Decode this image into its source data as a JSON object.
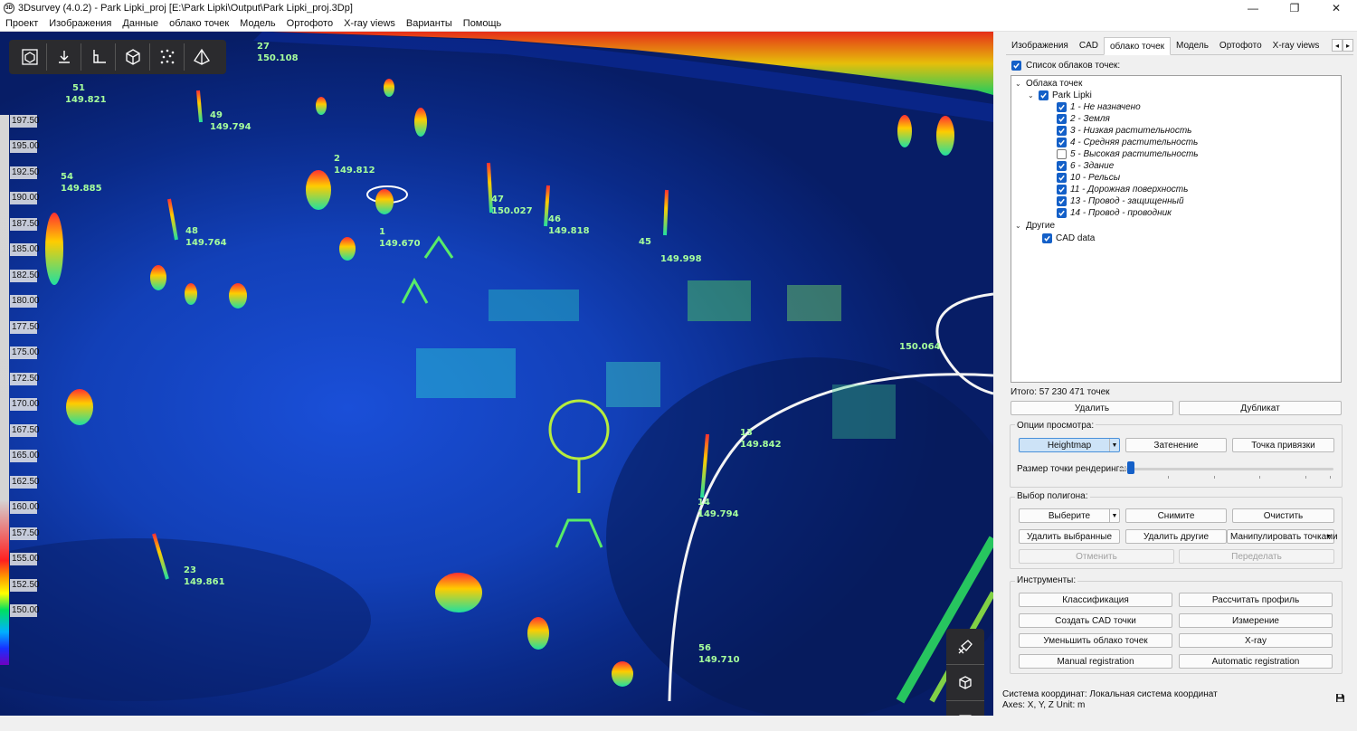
{
  "window": {
    "title": "3Dsurvey (4.0.2) - Park Lipki_proj [E:\\Park Lipki\\Output\\Park Lipki_proj.3Dp]",
    "icon_label": "3D",
    "minimize": "—",
    "maximize": "❐",
    "close": "✕"
  },
  "menu": [
    "Проект",
    "Изображения",
    "Данные",
    "облако точек",
    "Модель",
    "Ортофото",
    "X-ray views",
    "Варианты",
    "Помощь"
  ],
  "toolbar_icons": [
    "view-cube-icon",
    "download-icon",
    "axes-icon",
    "cube-icon",
    "scatter-icon",
    "prism-icon"
  ],
  "height_scale": [
    "197.50",
    "195.00",
    "192.50",
    "190.00",
    "187.50",
    "185.00",
    "182.50",
    "180.00",
    "177.50",
    "175.00",
    "172.50",
    "170.00",
    "167.50",
    "165.00",
    "162.50",
    "160.00",
    "157.50",
    "155.00",
    "152.50",
    "150.00"
  ],
  "markers": [
    {
      "id": "27",
      "value": "150.108"
    },
    {
      "id": "51",
      "value": "149.821"
    },
    {
      "id": "49",
      "value": "149.794"
    },
    {
      "id": "54",
      "value": "149.885"
    },
    {
      "id": "2",
      "value": "149.812"
    },
    {
      "id": "48",
      "value": "149.764"
    },
    {
      "id": "47",
      "value": "150.027"
    },
    {
      "id": "46",
      "value": "149.818"
    },
    {
      "id": "1",
      "value": "149.670"
    },
    {
      "id": "45",
      "value": "149.998"
    },
    {
      "id": "13",
      "value": "149.842"
    },
    {
      "id": "14",
      "value": "149.794"
    },
    {
      "id": "23",
      "value": "149.861"
    },
    {
      "id": "56",
      "value": "149.710"
    },
    {
      "id": "",
      "value": "150.064"
    }
  ],
  "tabs": [
    "Изображения",
    "CAD",
    "облако точек",
    "Модель",
    "Ортофото",
    "X-ray views"
  ],
  "active_tab": "облако точек",
  "tab_scroll": {
    "left": "◂",
    "right": "▸"
  },
  "pointcloud_list": {
    "label": "Список облаков точек:",
    "group_clouds": "Облака точек",
    "project": "Park Lipki",
    "classes": [
      {
        "label": "1 - Не назначено",
        "checked": true
      },
      {
        "label": "2 - Земля",
        "checked": true
      },
      {
        "label": "3 - Низкая растительность",
        "checked": true
      },
      {
        "label": "4 - Средняя растительность",
        "checked": true
      },
      {
        "label": "5 - Высокая растительность",
        "checked": false
      },
      {
        "label": "6 - Здание",
        "checked": true
      },
      {
        "label": "10 - Рельсы",
        "checked": true
      },
      {
        "label": "11 - Дорожная поверхность",
        "checked": true
      },
      {
        "label": "13 - Провод - защищенный",
        "checked": true
      },
      {
        "label": "14 - Провод - проводник",
        "checked": true
      }
    ],
    "group_other": "Другие",
    "cad_data": "CAD data",
    "total": "Итого: 57 230 471 точек"
  },
  "actions": {
    "delete": "Удалить",
    "duplicate": "Дубликат"
  },
  "view_options": {
    "title": "Опции просмотра:",
    "heightmap": "Heightmap",
    "shading": "Затенение",
    "anchor": "Точка привязки",
    "point_size_label": "Размер точки рендеринга:",
    "point_size_level": 0.05
  },
  "polygon": {
    "title": "Выбор полигона:",
    "select": "Выберите",
    "deselect": "Снимите",
    "clear": "Очистить",
    "delete_selected": "Удалить выбранные",
    "delete_others": "Удалить другие",
    "manipulate": "Манипулировать точками",
    "undo": "Отменить",
    "redo": "Переделать"
  },
  "tools": {
    "title": "Инструменты:",
    "classify": "Классификация",
    "profile": "Рассчитать профиль",
    "cad_points": "Создать CAD точки",
    "measure": "Измерение",
    "reduce": "Уменьшить облако точек",
    "xray": "X-ray",
    "manual_reg": "Manual registration",
    "auto_reg": "Automatic registration"
  },
  "status": {
    "crs": "Система координат: Локальная система координат",
    "axes": "Axes: X, Y, Z Unit: m"
  },
  "colors": {
    "accent": "#1460c8",
    "marker_text": "#a6ff9c",
    "toolbar_bg": "#2b2b2e"
  }
}
